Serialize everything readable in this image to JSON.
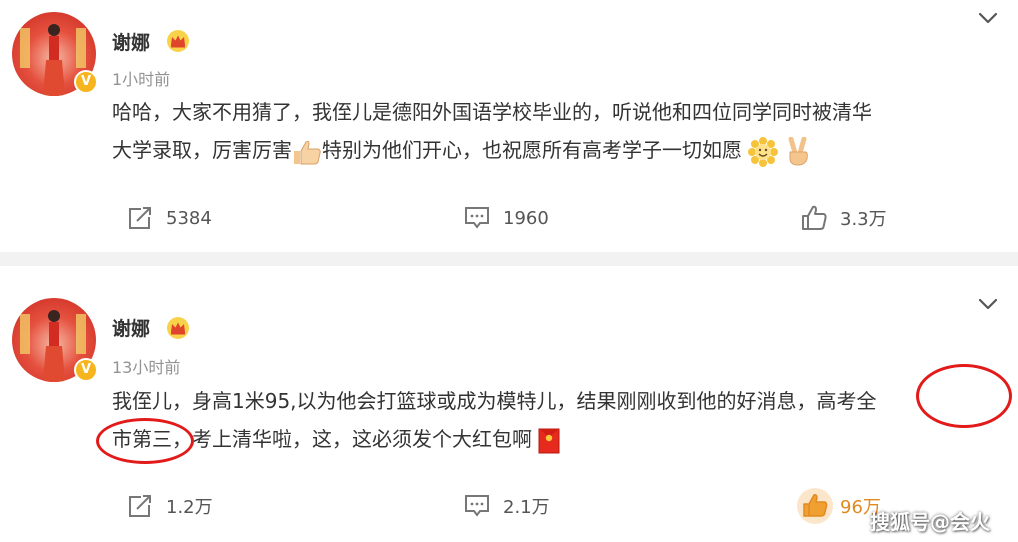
{
  "posts": [
    {
      "author": "谢娜",
      "time": "1小时前",
      "text_line1": "哈哈，大家不用猜了，我侄儿是德阳外国语学校毕业的，听说他和四位同学同时被清华",
      "text_line2a": "大学录取，厉害厉害",
      "text_line2b": "特别为他们开心，也祝愿所有高考学子一切如愿",
      "reposts": "5384",
      "comments": "1960",
      "likes": "3.3万"
    },
    {
      "author": "谢娜",
      "time": "13小时前",
      "text_line1a": "我侄儿，身高1米95,以为他会打篮球或成为模特儿，结果刚刚收到他的好消息，",
      "text_line1b": "高考全",
      "text_line2a": "市第三",
      "text_line2b": "，考上清华啦，这，这必须发个大红包啊",
      "reposts": "1.2万",
      "comments": "2.1万",
      "likes": "96万"
    }
  ],
  "icons": {
    "verified_badge": "V",
    "crown": "crown-icon",
    "more": "chevron-down-icon",
    "repost": "repost-icon",
    "comment": "comment-icon",
    "like": "thumbs-up-icon"
  },
  "colors": {
    "badge": "#f6b51e",
    "annotation_ring": "#e21a1a",
    "liked": "#f0a030"
  },
  "watermark": "搜狐号@会火"
}
